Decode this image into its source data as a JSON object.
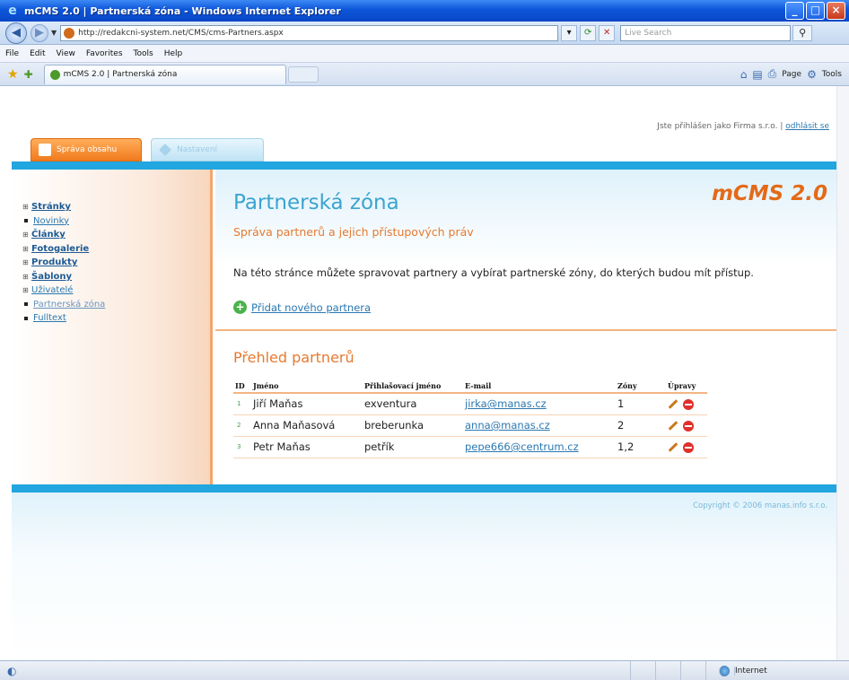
{
  "window": {
    "title": "mCMS 2.0 | Partnerská zóna - Windows Internet Explorer"
  },
  "browser": {
    "url": "http://redakcni-system.net/CMS/cms-Partners.aspx",
    "search_placeholder": "Live Search",
    "menu": [
      "File",
      "Edit",
      "View",
      "Favorites",
      "Tools",
      "Help"
    ],
    "tab_title": "mCMS 2.0 | Partnerská zóna",
    "toolbar": {
      "page_label": "Page",
      "tools_label": "Tools"
    },
    "status_zone": "Internet"
  },
  "page": {
    "user_text": "Jste přihlášen jako Firma s.r.o.",
    "logout_label": "odhlásit se",
    "tabs": [
      {
        "label": "Správa obsahu",
        "active": true
      },
      {
        "label": "Nastavení",
        "active": false
      }
    ],
    "sidebar": [
      {
        "label": "Stránky",
        "bold": true,
        "expandable": true
      },
      {
        "label": "Novinky",
        "bold": false,
        "expandable": false
      },
      {
        "label": "Články",
        "bold": true,
        "expandable": true
      },
      {
        "label": "Fotogalerie",
        "bold": true,
        "expandable": true
      },
      {
        "label": "Produkty",
        "bold": true,
        "expandable": true
      },
      {
        "label": "Šablony",
        "bold": true,
        "expandable": true
      },
      {
        "label": "Uživatelé",
        "bold": false,
        "expandable": true
      },
      {
        "label": "Partnerská zóna",
        "bold": false,
        "expandable": false
      },
      {
        "label": "Fulltext",
        "bold": false,
        "expandable": false
      }
    ],
    "title": "Partnerská zóna",
    "subtitle": "Správa partnerů a jejich přístupových práv",
    "brand": "mCMS 2.0",
    "intro": "Na této stránce můžete spravovat partnery a vybírat partnerské zóny, do kterých budou mít přístup.",
    "add_partner_label": "Přidat nového partnera",
    "section_title": "Přehled partnerů",
    "table": {
      "headers": [
        "ID",
        "Jméno",
        "Přihlašovací jméno",
        "E-mail",
        "Zóny",
        "Úpravy"
      ],
      "rows": [
        {
          "id": "1",
          "name": "Jiří Maňas",
          "login": "exventura",
          "email": "jirka@manas.cz",
          "zones": "1"
        },
        {
          "id": "2",
          "name": "Anna Maňasová",
          "login": "breberunka",
          "email": "anna@manas.cz",
          "zones": "2"
        },
        {
          "id": "3",
          "name": "Petr Maňas",
          "login": "petřík",
          "email": "pepe666@centrum.cz",
          "zones": "1,2"
        }
      ]
    },
    "copyright": "Copyright © 2006 manas.info s.r.o."
  },
  "colors": {
    "accent_blue": "#21a6df",
    "accent_orange": "#e67a2f",
    "link": "#2a78b0"
  }
}
